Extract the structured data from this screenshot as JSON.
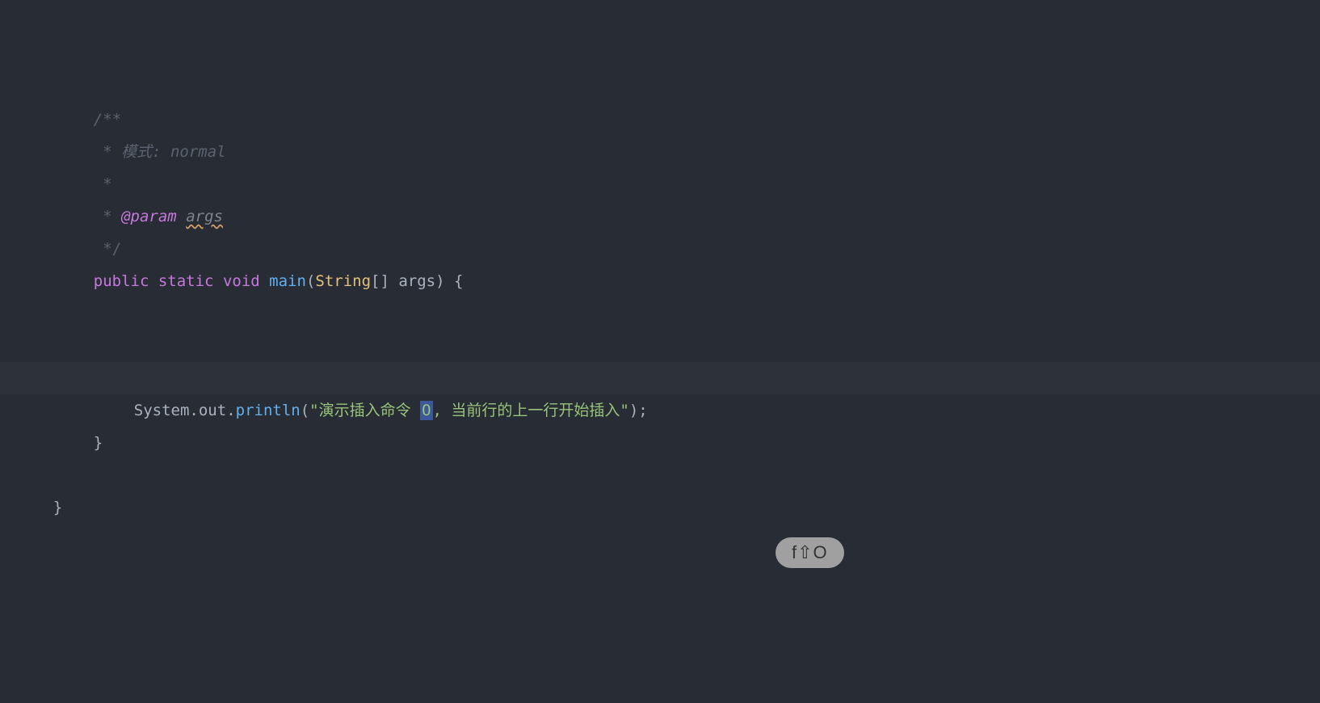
{
  "code": {
    "line1": "/**",
    "line2_prefix": " * ",
    "line2_text": "模式: normal",
    "line3": " *",
    "line4_prefix": " * ",
    "line4_annotation": "@param",
    "line4_space": " ",
    "line4_param": "args",
    "line5": " */",
    "line6": {
      "public": "public",
      "static": "static",
      "void": "void",
      "main": "main",
      "paren_open": "(",
      "String": "String",
      "brackets": "[]",
      "args": " args",
      "paren_close": ")",
      "brace": " {"
    },
    "line9": {
      "System": "System",
      "dot1": ".",
      "out": "out",
      "dot2": ".",
      "println": "println",
      "paren_open": "(",
      "string_start": "\"演示插入命令 ",
      "string_highlight": "O",
      "string_end": ", 当前行的上一行开始插入\"",
      "paren_close": ")",
      "semicolon": ";"
    },
    "line10": "}",
    "line12": "}"
  },
  "overlay": {
    "text": "f⇧O"
  }
}
